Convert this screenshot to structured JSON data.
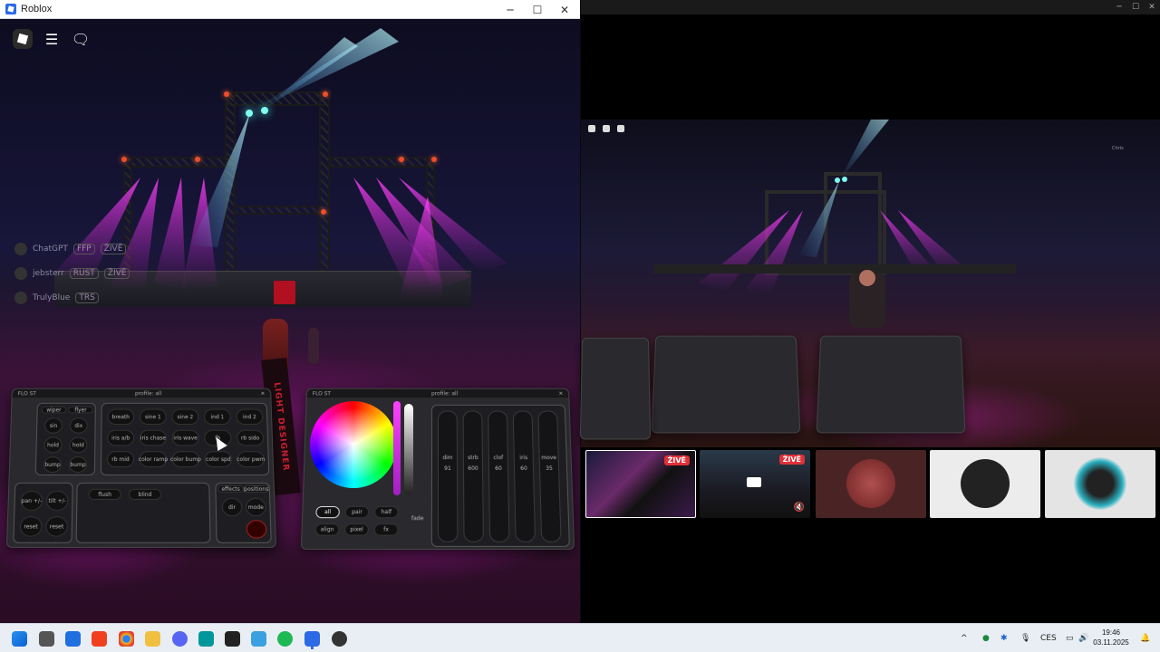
{
  "window": {
    "title": "Roblox",
    "min": "─",
    "max": "☐",
    "close": "✕"
  },
  "players": [
    {
      "name": "ChatGPT",
      "team": "FFP",
      "status": "ŽIVĚ"
    },
    {
      "name": "jebsterr",
      "team": "RUST",
      "status": "ŽIVĚ"
    },
    {
      "name": "TrulyBlue",
      "team": "TRS",
      "status": ""
    }
  ],
  "banner": "LIGHT DESIGNER",
  "left_console": {
    "header_left": "FLO ST",
    "header_mid": "profile: all",
    "tabs": [
      "wiper",
      "flyer"
    ],
    "pad_keys": [
      "sin",
      "dix",
      "hold",
      "hold",
      "bump",
      "bump"
    ],
    "grid_keys": [
      "breath",
      "sine 1",
      "sine 2",
      "ind 1",
      "ind 2",
      "iris a/b",
      "iris chase",
      "iris wave",
      "fb",
      "rb sido",
      "rb mid",
      "color ramp",
      "color bump",
      "color spd",
      "color pwm"
    ],
    "bottom_left_keys": [
      "pan +/-",
      "tilt +/-",
      "reset",
      "reset"
    ],
    "bottom_keys": [
      "flush",
      "blind"
    ],
    "side_tabs": [
      "effects",
      "positions"
    ],
    "side_keys": [
      "dir",
      "mode"
    ]
  },
  "color_console": {
    "header_left": "FLO ST",
    "header_mid": "profile: all",
    "buttons": [
      "all",
      "pair",
      "half",
      "align",
      "pixel",
      "fx"
    ],
    "fade_label": "fade",
    "faders": [
      {
        "label": "dim",
        "value": "91"
      },
      {
        "label": "strb",
        "value": "600"
      },
      {
        "label": "clof",
        "value": "60"
      },
      {
        "label": "iris",
        "value": "60"
      },
      {
        "label": "move",
        "value": "35"
      }
    ]
  },
  "right_view": {
    "player_tag": "Chris",
    "thumbs": [
      {
        "live": "ŽIVĚ"
      },
      {
        "live": "ŽIVĚ"
      },
      {
        "live": ""
      },
      {
        "live": ""
      },
      {
        "live": ""
      }
    ]
  },
  "tray": {
    "lang": "CES",
    "time": "19:46",
    "date": "03.11.2025"
  },
  "colors": {
    "accent": "#2b6ae4",
    "live": "#e0303a",
    "magenta": "#c020c0"
  }
}
